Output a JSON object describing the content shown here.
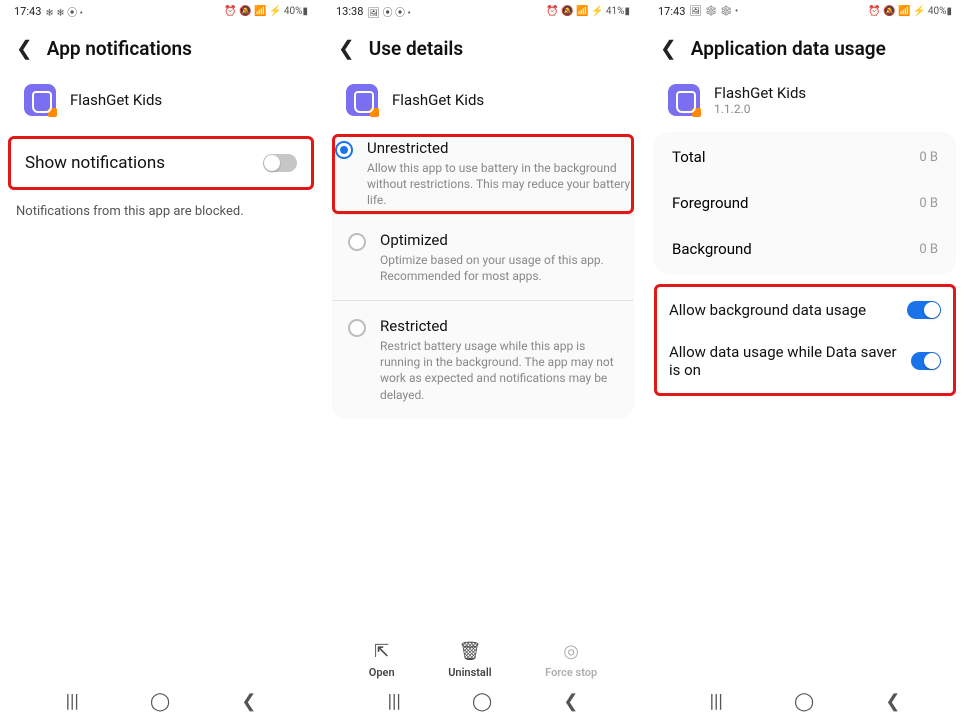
{
  "screen1": {
    "statusbar": {
      "time": "17:43",
      "left_icons": "❄ ❄ ⦿ •",
      "right_icons": "⏰ 🔕 📶 ⚡ 40%▮",
      "battery_text": "40%"
    },
    "header": {
      "title": "App notifications"
    },
    "app": {
      "name": "FlashGet Kids"
    },
    "toggle": {
      "label": "Show notifications",
      "on": false
    },
    "helper": "Notifications from this app are blocked."
  },
  "screen2": {
    "statusbar": {
      "time": "13:38",
      "left_icons": "🖼 ⦿ ⦿ •",
      "right_icons": "⏰ 🔕 📶 ⚡ 41%▮",
      "battery_text": "41%"
    },
    "header": {
      "title": "Use details"
    },
    "app": {
      "name": "FlashGet Kids"
    },
    "options": [
      {
        "title": "Unrestricted",
        "desc": "Allow this app to use battery in the background without restrictions. This may reduce your battery life.",
        "selected": true,
        "highlight": true
      },
      {
        "title": "Optimized",
        "desc": "Optimize based on your usage of this app. Recommended for most apps.",
        "selected": false,
        "highlight": false
      },
      {
        "title": "Restricted",
        "desc": "Restrict battery usage while this app is running in the background. The app may not work as expected and notifications may be delayed.",
        "selected": false,
        "highlight": false
      }
    ],
    "actions": {
      "open": "Open",
      "uninstall": "Uninstall",
      "forcestop": "Force stop",
      "forcestop_enabled": false
    }
  },
  "screen3": {
    "statusbar": {
      "time": "17:43",
      "left_icons": "🖼 ❄ ❄ •",
      "right_icons": "⏰ 🔕 📶 ⚡ 40%▮",
      "battery_text": "40%"
    },
    "header": {
      "title": "Application data usage"
    },
    "app": {
      "name": "FlashGet Kids",
      "version": "1.1.2.0"
    },
    "rows": [
      {
        "label": "Total",
        "value": "0 B"
      },
      {
        "label": "Foreground",
        "value": "0 B"
      },
      {
        "label": "Background",
        "value": "0 B"
      }
    ],
    "toggles": [
      {
        "label": "Allow background data usage",
        "on": true
      },
      {
        "label": "Allow data usage while Data saver is on",
        "on": true
      }
    ]
  },
  "nav_icons": {
    "recent": "|||",
    "home": "◯",
    "back": "❮"
  }
}
